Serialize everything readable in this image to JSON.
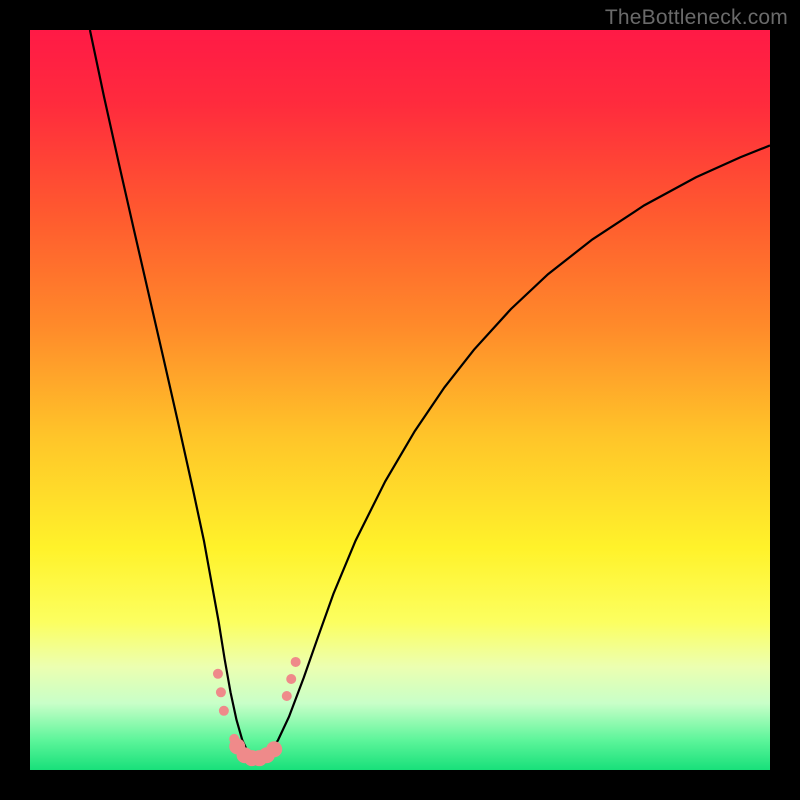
{
  "watermark": "TheBottleneck.com",
  "chart_data": {
    "type": "line",
    "title": "",
    "xlabel": "",
    "ylabel": "",
    "xlim": [
      0,
      100
    ],
    "ylim": [
      0,
      100
    ],
    "background_gradient": {
      "stops": [
        {
          "pos": 0.0,
          "color": "#ff1a46"
        },
        {
          "pos": 0.1,
          "color": "#ff2b3d"
        },
        {
          "pos": 0.25,
          "color": "#ff5a2f"
        },
        {
          "pos": 0.4,
          "color": "#ff8a2a"
        },
        {
          "pos": 0.55,
          "color": "#ffc529"
        },
        {
          "pos": 0.7,
          "color": "#fff22a"
        },
        {
          "pos": 0.8,
          "color": "#fcff60"
        },
        {
          "pos": 0.86,
          "color": "#ecffb0"
        },
        {
          "pos": 0.91,
          "color": "#c8ffc8"
        },
        {
          "pos": 0.96,
          "color": "#5cf59a"
        },
        {
          "pos": 1.0,
          "color": "#18e07a"
        }
      ]
    },
    "series": [
      {
        "name": "bottleneck-curve",
        "color": "#000000",
        "width": 2.2,
        "x": [
          8.1,
          10,
          12,
          14,
          16,
          18,
          20,
          22,
          23.5,
          24.5,
          25.5,
          26.3,
          27.1,
          27.9,
          28.7,
          29.5,
          30.3,
          31.2,
          32.2,
          33.5,
          35,
          37,
          39,
          41,
          44,
          48,
          52,
          56,
          60,
          65,
          70,
          76,
          83,
          90,
          96,
          100
        ],
        "y": [
          100,
          91,
          82,
          73.2,
          64.5,
          55.8,
          47,
          38,
          31,
          25.5,
          20,
          15,
          10.5,
          6.8,
          4.0,
          2.3,
          1.6,
          1.6,
          2.3,
          4.0,
          7.2,
          12.5,
          18.2,
          23.8,
          31.0,
          39.0,
          45.8,
          51.7,
          56.8,
          62.3,
          67.0,
          71.7,
          76.3,
          80.1,
          82.8,
          84.4
        ]
      }
    ],
    "markers": {
      "name": "highlight-points",
      "color": "#ef8a8a",
      "radius_small": 5,
      "radius_large": 8,
      "points": [
        {
          "x": 25.4,
          "y": 13.0,
          "r": "small"
        },
        {
          "x": 25.8,
          "y": 10.5,
          "r": "small"
        },
        {
          "x": 26.2,
          "y": 8.0,
          "r": "small"
        },
        {
          "x": 27.6,
          "y": 4.2,
          "r": "small"
        },
        {
          "x": 28.0,
          "y": 3.2,
          "r": "large"
        },
        {
          "x": 29.0,
          "y": 2.0,
          "r": "large"
        },
        {
          "x": 30.0,
          "y": 1.6,
          "r": "large"
        },
        {
          "x": 31.0,
          "y": 1.6,
          "r": "large"
        },
        {
          "x": 32.0,
          "y": 2.0,
          "r": "large"
        },
        {
          "x": 33.0,
          "y": 2.8,
          "r": "large"
        },
        {
          "x": 34.7,
          "y": 10.0,
          "r": "small"
        },
        {
          "x": 35.3,
          "y": 12.3,
          "r": "small"
        },
        {
          "x": 35.9,
          "y": 14.6,
          "r": "small"
        }
      ]
    }
  }
}
